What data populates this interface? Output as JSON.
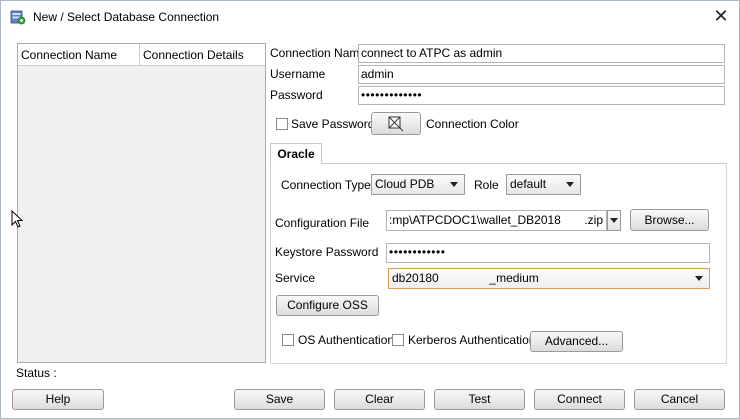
{
  "window": {
    "title": "New / Select Database Connection"
  },
  "conn_table": {
    "headers": [
      "Connection Name",
      "Connection Details"
    ]
  },
  "form": {
    "connection_name_label": "Connection Name",
    "connection_name_value": "connect to ATPC as admin",
    "username_label": "Username",
    "username_value": "admin",
    "password_label": "Password",
    "password_value": "•••••••••••••",
    "save_password_label": "Save Password",
    "connection_color_label": "Connection Color"
  },
  "tab": {
    "label": "Oracle"
  },
  "oracle": {
    "connection_type_label": "Connection Type",
    "connection_type_value": "Cloud PDB",
    "role_label": "Role",
    "role_value": "default",
    "config_file_label": "Configuration File",
    "config_file_value": ":mp\\ATPCDOC1\\wallet_DB2018",
    "config_file_ext": ".zip",
    "browse_label": "Browse...",
    "keystore_label": "Keystore Password",
    "keystore_value": "••••••••••••",
    "service_label": "Service",
    "service_value_prefix": "db20180",
    "service_value_suffix": "_medium",
    "configure_oss_label": "Configure OSS",
    "os_auth_label": "OS Authentication",
    "kerberos_label": "Kerberos Authentication",
    "advanced_label": "Advanced..."
  },
  "status": {
    "label": "Status :"
  },
  "buttons": {
    "help": "Help",
    "save": "Save",
    "clear": "Clear",
    "test": "Test",
    "connect": "Connect",
    "cancel": "Cancel"
  }
}
